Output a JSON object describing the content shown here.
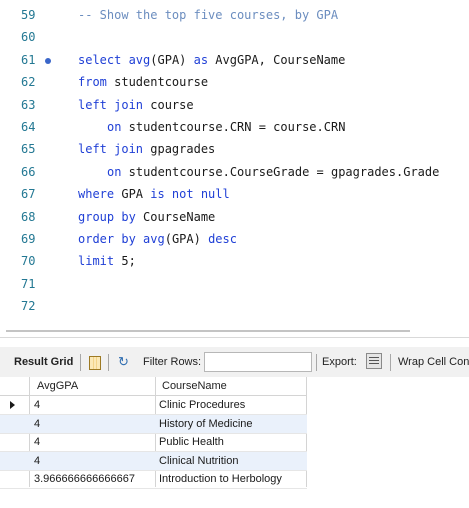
{
  "editor": {
    "lines": [
      {
        "n": "59",
        "parts": [
          {
            "t": "-- Show the top five courses, by GPA",
            "c": "cm"
          }
        ]
      },
      {
        "n": "60",
        "parts": []
      },
      {
        "n": "61",
        "marker": true,
        "parts": [
          {
            "t": "select ",
            "c": "kw"
          },
          {
            "t": "avg",
            "c": "kw"
          },
          {
            "t": "(GPA) ",
            "c": ""
          },
          {
            "t": "as",
            "c": "kw"
          },
          {
            "t": " AvgGPA, CourseName",
            "c": ""
          }
        ]
      },
      {
        "n": "62",
        "parts": [
          {
            "t": "from",
            "c": "kw"
          },
          {
            "t": " studentcourse",
            "c": ""
          }
        ]
      },
      {
        "n": "63",
        "parts": [
          {
            "t": "left join",
            "c": "kw"
          },
          {
            "t": " course",
            "c": ""
          }
        ]
      },
      {
        "n": "64",
        "indent": true,
        "parts": [
          {
            "t": "on",
            "c": "kw"
          },
          {
            "t": " studentcourse.CRN = course.CRN",
            "c": ""
          }
        ]
      },
      {
        "n": "65",
        "parts": [
          {
            "t": "left join",
            "c": "kw"
          },
          {
            "t": " gpagrades",
            "c": ""
          }
        ]
      },
      {
        "n": "66",
        "indent": true,
        "parts": [
          {
            "t": "on",
            "c": "kw"
          },
          {
            "t": " studentcourse.CourseGrade = gpagrades.Grade",
            "c": ""
          }
        ]
      },
      {
        "n": "67",
        "parts": [
          {
            "t": "where",
            "c": "kw"
          },
          {
            "t": " GPA ",
            "c": ""
          },
          {
            "t": "is not null",
            "c": "kw"
          }
        ]
      },
      {
        "n": "68",
        "parts": [
          {
            "t": "group by",
            "c": "kw"
          },
          {
            "t": " CourseName",
            "c": ""
          }
        ]
      },
      {
        "n": "69",
        "parts": [
          {
            "t": "order by",
            "c": "kw"
          },
          {
            "t": " ",
            "c": ""
          },
          {
            "t": "avg",
            "c": "kw"
          },
          {
            "t": "(GPA) ",
            "c": ""
          },
          {
            "t": "desc",
            "c": "kw"
          }
        ]
      },
      {
        "n": "70",
        "parts": [
          {
            "t": "limit",
            "c": "kw"
          },
          {
            "t": " 5;",
            "c": ""
          }
        ]
      },
      {
        "n": "71",
        "parts": []
      },
      {
        "n": "72",
        "parts": []
      }
    ]
  },
  "toolbar": {
    "result_grid_label": "Result Grid",
    "filter_rows_label": "Filter Rows:",
    "filter_rows_value": "",
    "export_label": "Export:",
    "wrap_label": "Wrap Cell Con"
  },
  "grid": {
    "columns": [
      "AvgGPA",
      "CourseName"
    ],
    "rows": [
      [
        "4",
        "Clinic Procedures"
      ],
      [
        "4",
        "History of Medicine"
      ],
      [
        "4",
        "Public Health"
      ],
      [
        "4",
        "Clinical Nutrition"
      ],
      [
        "3.966666666666667",
        "Introduction to Herbology"
      ]
    ]
  },
  "colors": {
    "keyword": "#1f3fd6",
    "comment": "#6b8dbf",
    "line_number": "#237893",
    "row_alt": "#eaf1fb"
  }
}
